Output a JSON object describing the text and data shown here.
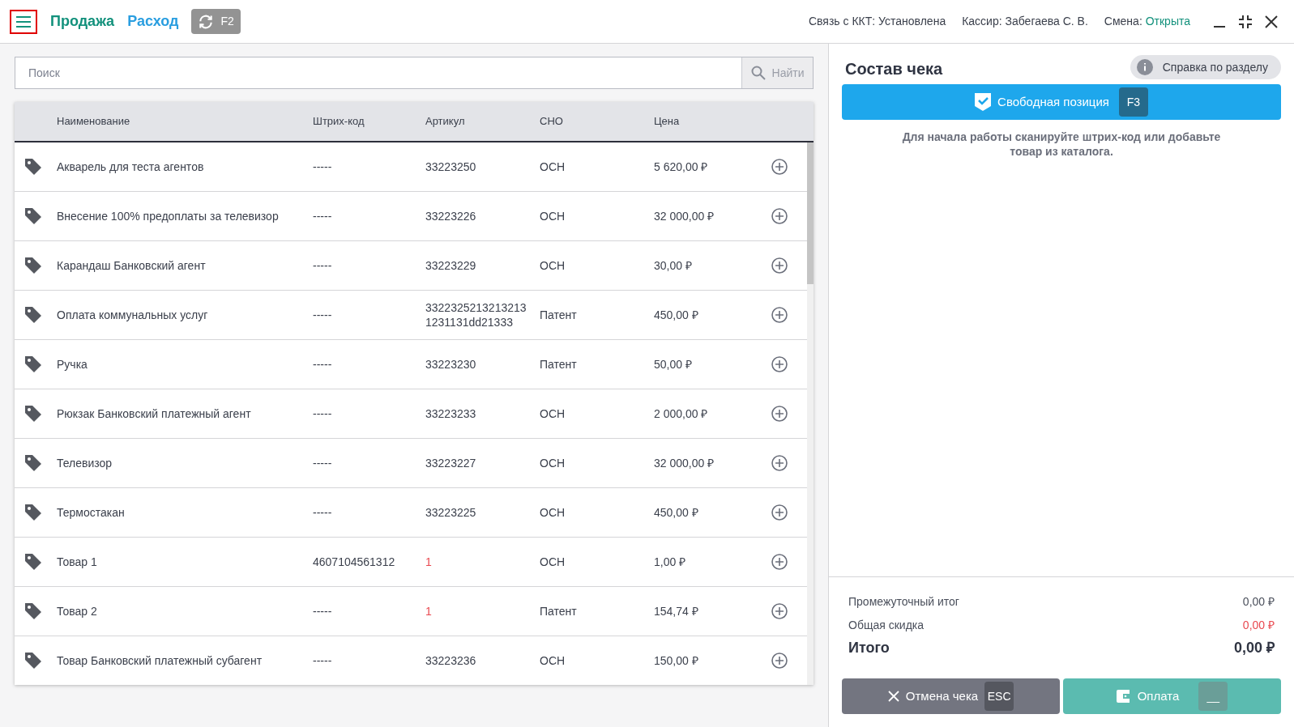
{
  "header": {
    "tabs": [
      {
        "label": "Продажа",
        "selected": true
      },
      {
        "label": "Расход",
        "selected": false
      }
    ],
    "sync_button": {
      "key": "F2"
    },
    "status": [
      {
        "label": "Связь с ККТ:",
        "value": "Установлена",
        "highlight": false
      },
      {
        "label": "Кассир:",
        "value": "Забегаева С. В.",
        "highlight": false
      },
      {
        "label": "Смена:",
        "value": "Открыта",
        "highlight": true
      }
    ]
  },
  "search": {
    "placeholder": "Поиск",
    "button": "Найти"
  },
  "table": {
    "columns": [
      "Наименование",
      "Штрих-код",
      "Артикул",
      "СНО",
      "Цена"
    ],
    "rows": [
      {
        "name": "Акварель для теста агентов",
        "barcode": "-----",
        "article": "33223250",
        "article_flagged": false,
        "tax": "ОСН",
        "price": "5 620,00 ₽"
      },
      {
        "name": "Внесение 100% предоплаты за телевизор",
        "barcode": "-----",
        "article": "33223226",
        "article_flagged": false,
        "tax": "ОСН",
        "price": "32 000,00 ₽"
      },
      {
        "name": "Карандаш Банковский агент",
        "barcode": "-----",
        "article": "33223229",
        "article_flagged": false,
        "tax": "ОСН",
        "price": "30,00 ₽"
      },
      {
        "name": "Оплата коммунальных услуг",
        "barcode": "-----",
        "article": "33223252132132131231131dd21333",
        "article_flagged": false,
        "tax": "Патент",
        "price": "450,00 ₽"
      },
      {
        "name": "Ручка",
        "barcode": "-----",
        "article": "33223230",
        "article_flagged": false,
        "tax": "Патент",
        "price": "50,00 ₽"
      },
      {
        "name": "Рюкзак Банковский платежный агент",
        "barcode": "-----",
        "article": "33223233",
        "article_flagged": false,
        "tax": "ОСН",
        "price": "2 000,00 ₽"
      },
      {
        "name": "Телевизор",
        "barcode": "-----",
        "article": "33223227",
        "article_flagged": false,
        "tax": "ОСН",
        "price": "32 000,00 ₽"
      },
      {
        "name": "Термостакан",
        "barcode": "-----",
        "article": "33223225",
        "article_flagged": false,
        "tax": "ОСН",
        "price": "450,00 ₽"
      },
      {
        "name": "Товар 1",
        "barcode": "4607104561312",
        "article": "1",
        "article_flagged": true,
        "tax": "ОСН",
        "price": "1,00 ₽"
      },
      {
        "name": "Товар 2",
        "barcode": "-----",
        "article": "1",
        "article_flagged": true,
        "tax": "Патент",
        "price": "154,74 ₽"
      },
      {
        "name": "Товар Банковский платежный субагент",
        "barcode": "-----",
        "article": "33223236",
        "article_flagged": false,
        "tax": "ОСН",
        "price": "150,00 ₽"
      }
    ]
  },
  "receipt": {
    "title": "Состав чека",
    "help_button": "Справка по разделу",
    "free_item_button": {
      "label": "Свободная позиция",
      "key": "F3"
    },
    "hint": "Для начала работы сканируйте штрих-код или добавьте товар из каталога.",
    "subtotal": {
      "label": "Промежуточный итог",
      "value": "0,00 ₽"
    },
    "discount": {
      "label": "Общая скидка",
      "value": "0,00 ₽"
    },
    "total": {
      "label": "Итого",
      "value": "0,00 ₽"
    },
    "cancel_button": {
      "label": "Отмена чека",
      "key": "ESC"
    },
    "pay_button": {
      "label": "Оплата",
      "key": "__"
    }
  }
}
